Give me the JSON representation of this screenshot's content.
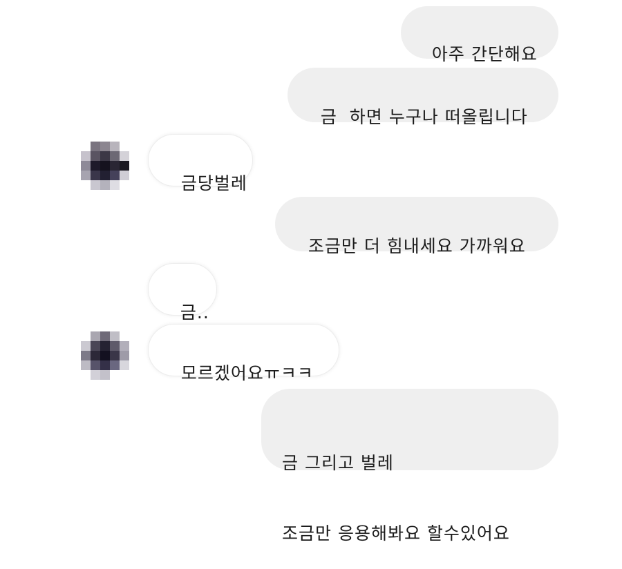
{
  "messages": [
    {
      "sender": "me",
      "text": "아주 간단해요"
    },
    {
      "sender": "me",
      "text": "금  하면 누구나 떠올립니다"
    },
    {
      "sender": "them",
      "text": "금당벌레"
    },
    {
      "sender": "me",
      "text": "조금만 더 힘내세요 가까워요"
    },
    {
      "sender": "them",
      "text": "금.."
    },
    {
      "sender": "them",
      "text": "모르겠어요ㅠㅋㅋ"
    },
    {
      "sender": "me",
      "lines": [
        "금 그리고 벌레",
        "조금만 응용해봐요 할수있어요"
      ]
    }
  ],
  "colors": {
    "outgoing_bubble": "#efefef",
    "incoming_bubble": "#ffffff",
    "text": "#1a1a1a"
  },
  "icons": {
    "avatar": "pixelated-avatar-icon"
  }
}
